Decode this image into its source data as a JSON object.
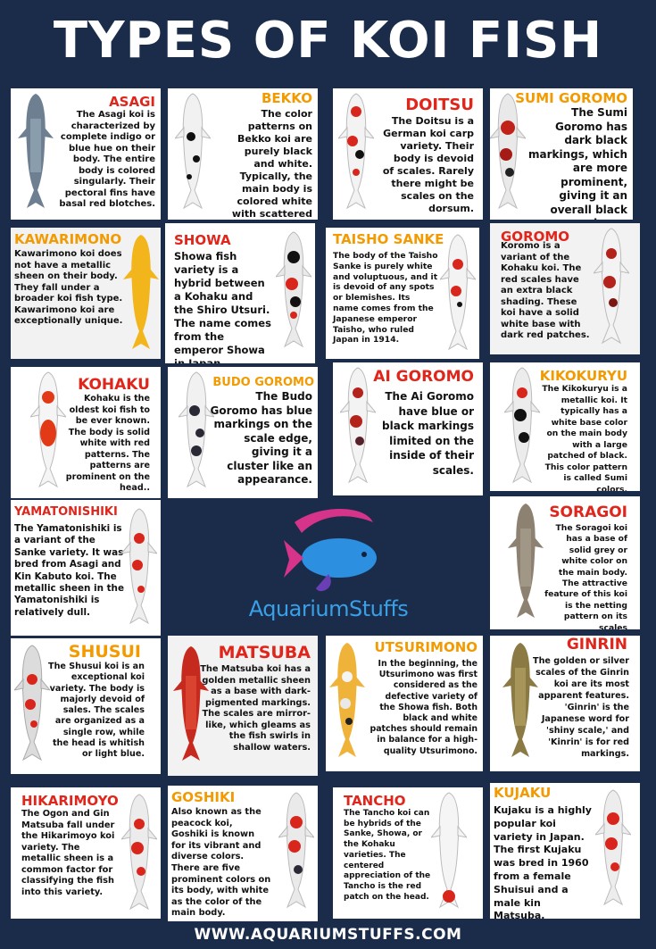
{
  "title": "TYPES OF KOI FISH",
  "footer": "WWW.AQUARIUMSTUFFS.COM",
  "logo_text": "AquariumStuffs",
  "koi": [
    {
      "name": "ASAGI",
      "desc": "The Asagi koi is characterized by complete indigo or blue hue on their body. The entire body is colored singularly. Their pectoral fins have basal red blotches."
    },
    {
      "name": "BEKKO",
      "desc": "The color patterns on Bekko koi are purely black and white. Typically, the main body is colored white with scattered black patches."
    },
    {
      "name": "DOITSU",
      "desc": "The Doitsu is a German koi carp variety. Their body is devoid of scales. Rarely there might be scales on the dorsum."
    },
    {
      "name": "SUMI GOROMO",
      "desc": "The Sumi Goromo has dark black markings, which are more prominent, giving it an overall black sheen."
    },
    {
      "name": "KAWARIMONO",
      "desc": "Kawarimono koi does not have a metallic sheen on their body. They fall under a broader koi fish type. Kawarimono koi are exceptionally unique."
    },
    {
      "name": "SHOWA",
      "desc": "Showa fish variety is a hybrid between a Kohaku and the Shiro Utsuri. The name comes from the emperor Showa in Japan."
    },
    {
      "name": "TAISHO SANKE",
      "desc": "The body of the Taisho Sanke is purely white and voluptuous, and it is devoid of any spots or blemishes. Its name comes from the Japanese emperor Taisho, who ruled Japan in 1914."
    },
    {
      "name": "GOROMO",
      "desc": "Koromo is a variant of the Kohaku koi. The red scales have an extra black shading. These koi have a solid white base with dark red patches."
    },
    {
      "name": "KOHAKU",
      "desc": "Kohaku is the oldest koi fish to be ever known. The body is solid white with red patterns. The patterns are prominent on the head.."
    },
    {
      "name": "BUDO GOROMO",
      "desc": "The Budo Goromo has blue markings on the scale edge, giving it a cluster like an appearance."
    },
    {
      "name": "AI GOROMO",
      "desc": "The Ai Goromo have blue or black markings limited on the inside of their scales."
    },
    {
      "name": "KIKOKURYU",
      "desc": "The Kikokuryu is a metallic koi. It typically has a white base color on the main body with a large patched of black. This color pattern is called Sumi colors."
    },
    {
      "name": "YAMATONISHIKI",
      "desc": "The Yamatonishiki is a variant of the Sanke variety. It was bred from Asagi and Kin Kabuto koi. The metallic sheen in the Yamatonishiki is relatively dull."
    },
    {
      "name": "SORAGOI",
      "desc": "The Soragoi koi has a base of solid grey or white color on the main body. The attractive feature of this koi is the netting pattern on its scales"
    },
    {
      "name": "SHUSUI",
      "desc": "The Shusui koi is an exceptional koi variety. The body is majorly devoid of sales. The scales are organized as a single row, while the head is whitish or light blue."
    },
    {
      "name": "MATSUBA",
      "desc": "The Matsuba koi has a golden metallic sheen as a base with dark-pigmented markings. The scales are mirror-like, which gleams as the fish swirls in shallow waters."
    },
    {
      "name": "UTSURIMONO",
      "desc": "In the beginning, the Utsurimono was first considered as the defective variety of the Showa fish. Both black and white patches should remain in balance for a high-quality Utsurimono."
    },
    {
      "name": "GINRIN",
      "desc": "The golden or silver scales of the Ginrin koi are its most apparent features. 'Ginrin' is the Japanese word for 'shiny scale,' and 'Kinrin' is for red markings."
    },
    {
      "name": "HIKARIMOYO",
      "desc": "The Ogon and Gin Matsuba fall under the Hikarimoyo koi variety. The metallic sheen is a common factor for classifying the fish into this variety."
    },
    {
      "name": "GOSHIKI",
      "desc": "Also known as the peacock koi, Goshiki is known for its vibrant and diverse colors. There are five prominent colors on its body, with white as the color of the main body."
    },
    {
      "name": "TANCHO",
      "desc": "The Tancho koi can be hybrids of the Sanke, Showa, or the Kohaku varieties. The centered appreciation of the Tancho is the red patch on the head."
    },
    {
      "name": "KUJAKU",
      "desc": "Kujaku is a highly popular koi variety in Japan. The first Kujaku was bred in 1960 from a female Shuisui and a male kin Matsuba."
    }
  ],
  "colors": {
    "background": "#1b2c4a",
    "name_red": "#e0251b",
    "name_orange": "#f29a00",
    "logo_blue": "#3aa0e6",
    "logo_pink": "#d6338a"
  }
}
